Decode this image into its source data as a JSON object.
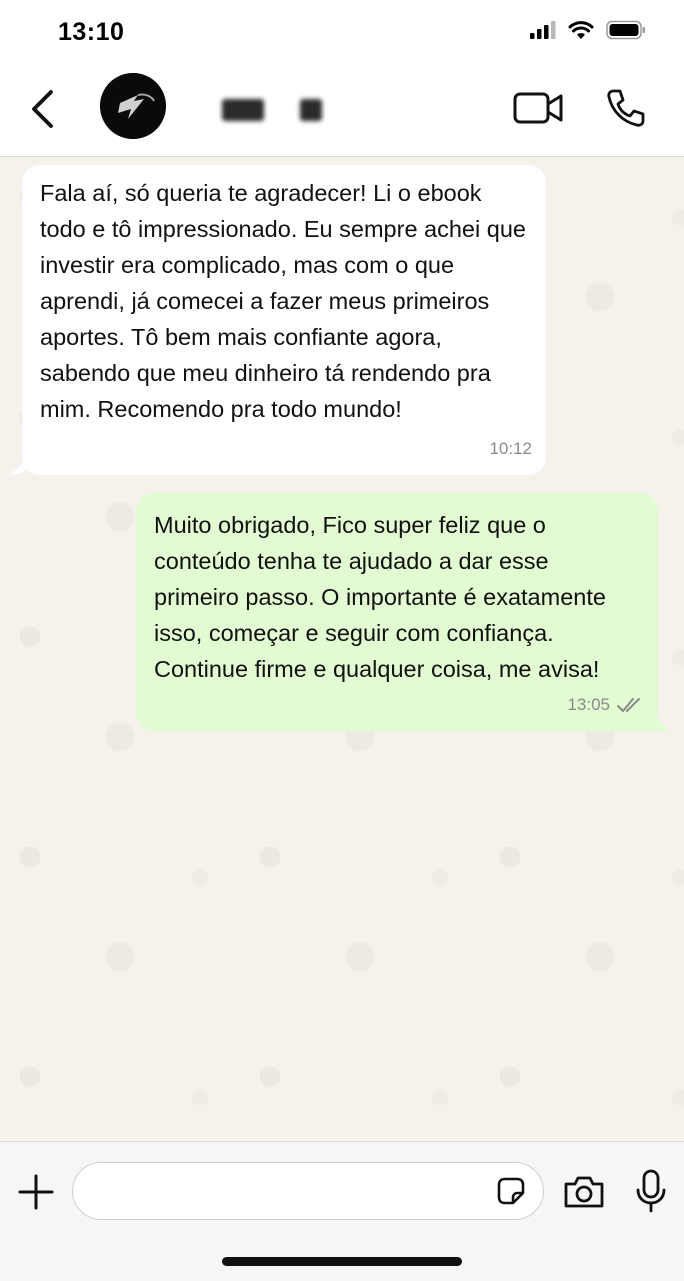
{
  "status_bar": {
    "time": "13:10",
    "icons": [
      "signal-icon",
      "wifi-icon",
      "battery-icon"
    ]
  },
  "header": {
    "back_icon": "chevron-left-icon",
    "avatar_icon": "avatar-logo",
    "actions": [
      "video-call-icon",
      "phone-icon"
    ]
  },
  "messages": [
    {
      "direction": "incoming",
      "text": "Fala aí, só queria te agradecer! Li o ebook todo e tô impressionado. Eu sempre achei que investir era complicado, mas com o que aprendi, já comecei a fazer meus primeiros aportes. Tô bem mais confiante agora, sabendo que meu dinheiro tá rendendo pra mim. Recomendo pra todo mundo!",
      "time": "10:12"
    },
    {
      "direction": "outgoing",
      "text": "Muito obrigado, Fico super feliz que o conteúdo tenha te ajudado a dar esse primeiro passo. O importante é exatamente isso, começar e seguir com confiança. Continue firme e qualquer coisa, me avisa!",
      "time": "13:05",
      "status_icon": "double-check-icon"
    }
  ],
  "input_bar": {
    "placeholder": "",
    "icons": [
      "plus-icon",
      "sticker-icon",
      "camera-icon",
      "microphone-icon"
    ]
  },
  "colors": {
    "chat_background": "#f5f2eb",
    "incoming_bubble": "#ffffff",
    "outgoing_bubble": "#e3fbd2",
    "timestamp": "#8a8a8a"
  }
}
